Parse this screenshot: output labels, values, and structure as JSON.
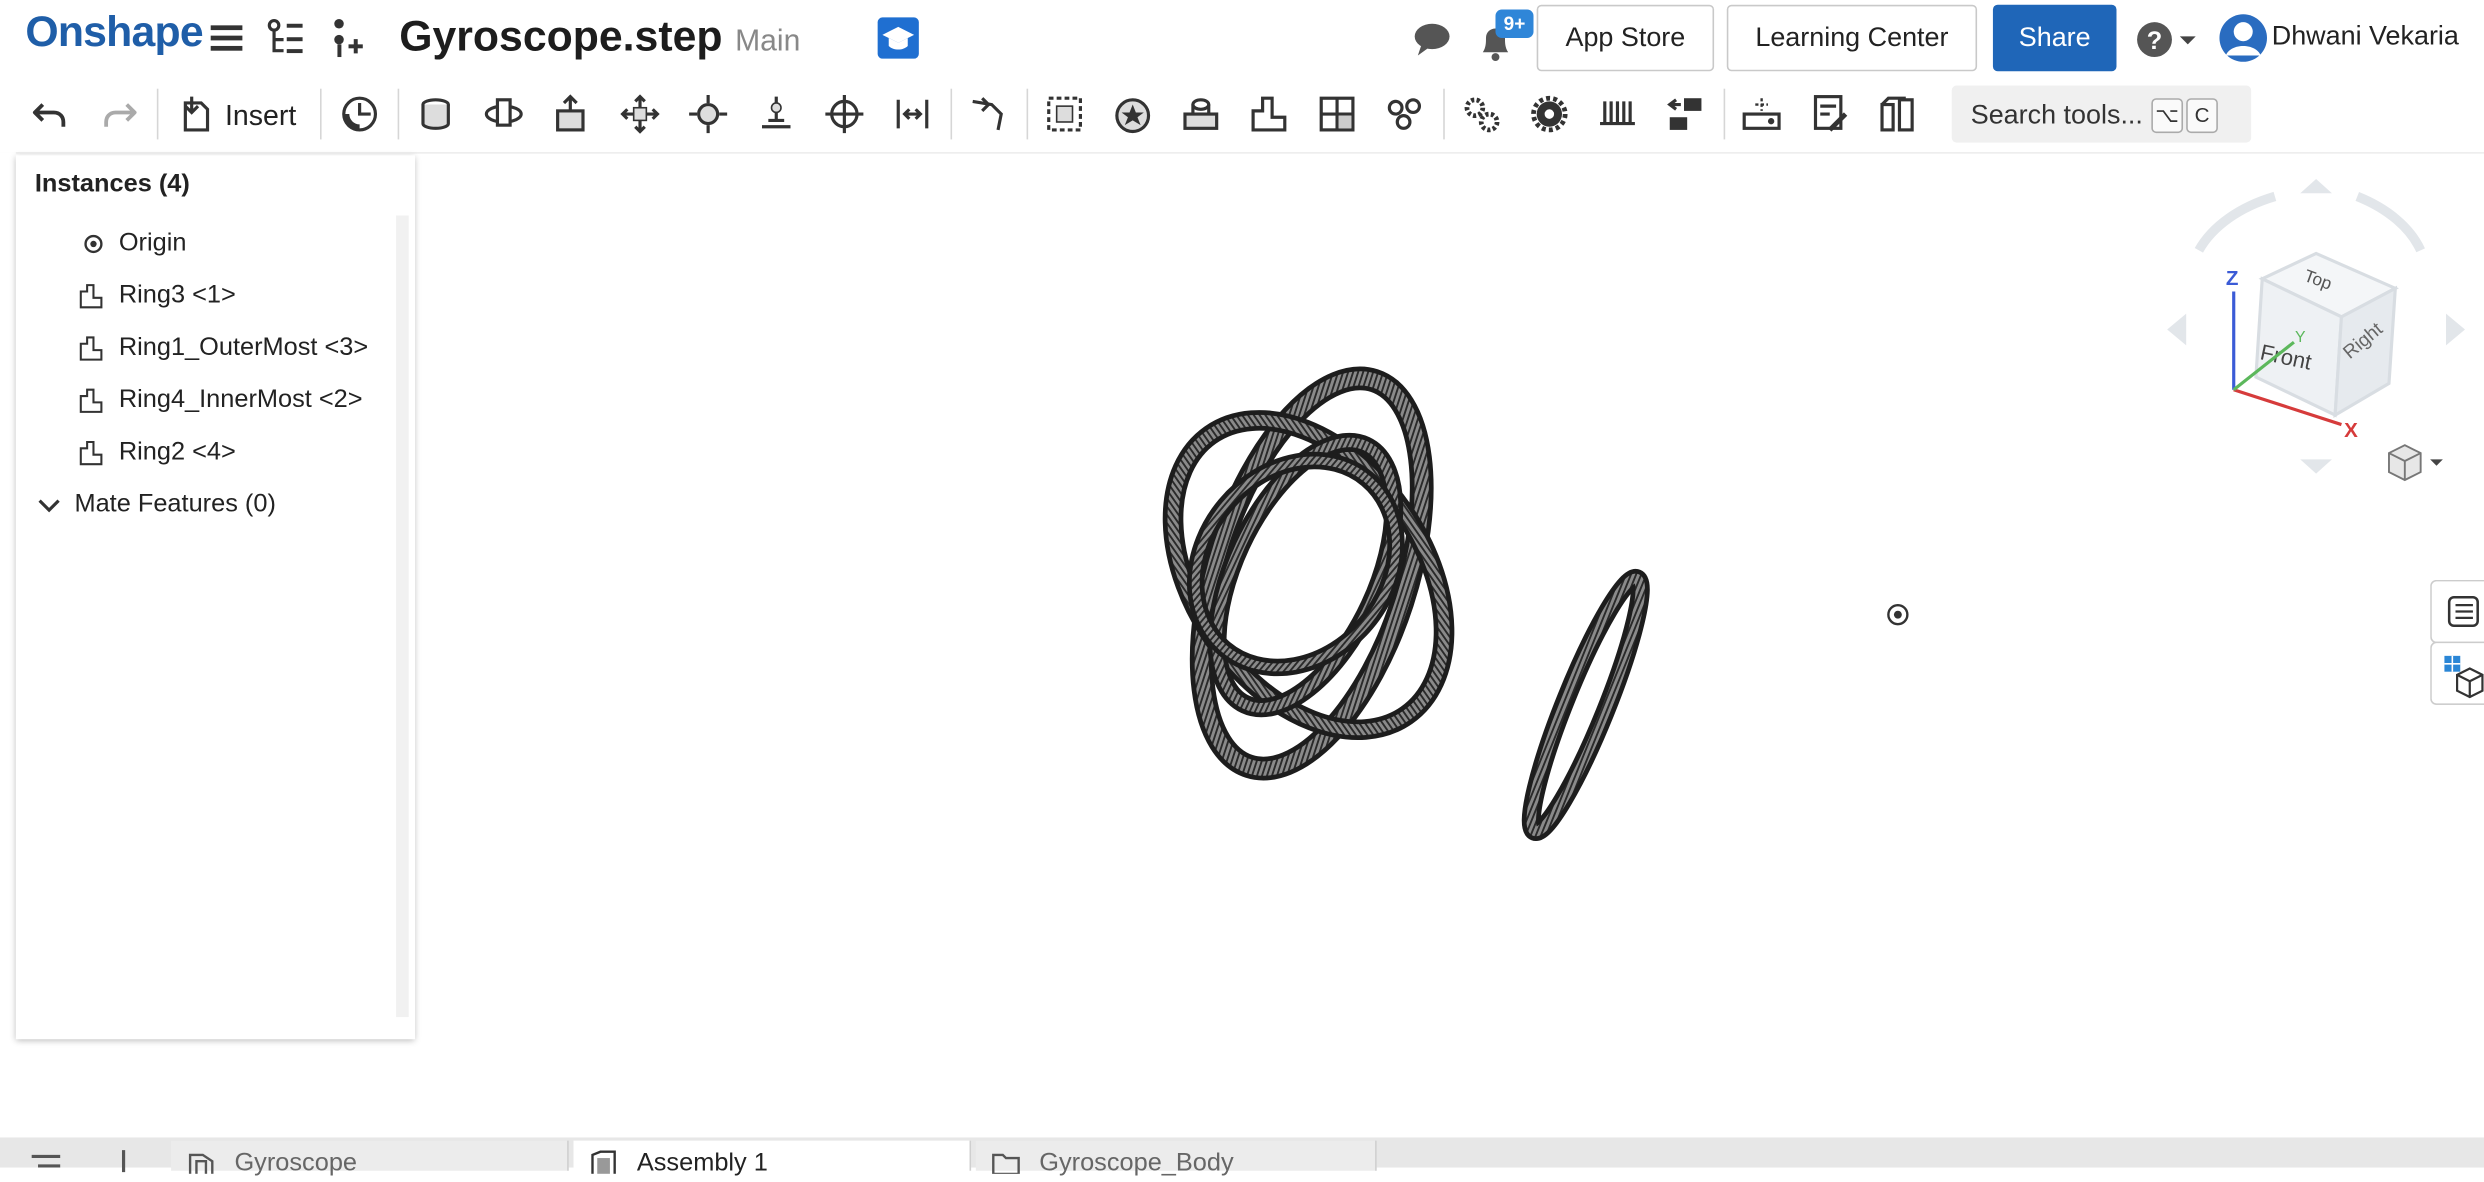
{
  "app": {
    "logo_text": "Onshape",
    "brand_color": "#1f5ea8"
  },
  "document": {
    "title": "Gyroscope.step",
    "branch": "Main"
  },
  "header": {
    "notifications_badge": "9+",
    "app_store_label": "App Store",
    "learning_center_label": "Learning Center",
    "share_label": "Share",
    "user_name": "Dhwani Vekaria",
    "share_color": "#1f66b8"
  },
  "toolbar": {
    "insert_label": "Insert",
    "search_placeholder": "Search tools...",
    "shortcut_keys": [
      "⌥",
      "C"
    ]
  },
  "instances_panel": {
    "title": "Instances (4)",
    "items": [
      {
        "label": "Origin",
        "icon": "origin-icon"
      },
      {
        "label": "Ring3 <1>",
        "icon": "part-instance-icon"
      },
      {
        "label": "Ring1_OuterMost <3>",
        "icon": "part-instance-icon"
      },
      {
        "label": "Ring4_InnerMost <2>",
        "icon": "part-instance-icon"
      },
      {
        "label": "Ring2 <4>",
        "icon": "part-instance-icon"
      }
    ],
    "mate_features_label": "Mate Features (0)"
  },
  "view_cube": {
    "faces": [
      "Top",
      "Front",
      "Right"
    ],
    "axes": [
      "Z",
      "Y",
      "X"
    ]
  },
  "tabs": [
    {
      "label": "Gyroscope",
      "icon": "part-studio-icon",
      "active": false
    },
    {
      "label": "Assembly 1",
      "icon": "assembly-icon",
      "active": true
    },
    {
      "label": "Gyroscope_Body",
      "icon": "folder-icon",
      "active": false
    }
  ]
}
